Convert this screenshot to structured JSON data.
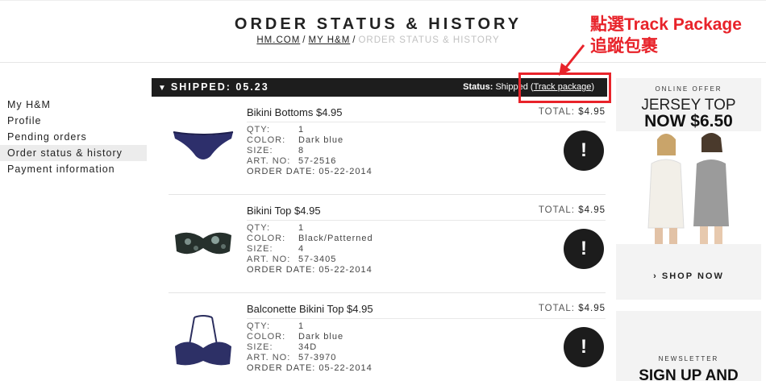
{
  "header": {
    "title": "ORDER STATUS & HISTORY",
    "breadcrumb": [
      "HM.COM",
      "MY H&M",
      "ORDER STATUS & HISTORY"
    ],
    "separator": "/"
  },
  "annotation": {
    "line1": "點選Track Package",
    "line2": "追蹤包裹",
    "color": "#e8232a"
  },
  "sidebar": {
    "items": [
      {
        "label": "My H&M"
      },
      {
        "label": "Profile"
      },
      {
        "label": "Pending orders"
      },
      {
        "label": "Order status & history"
      },
      {
        "label": "Payment information"
      }
    ]
  },
  "shipment": {
    "title": "SHIPPED: 05.23",
    "status_label": "Status:",
    "status_value": "Shipped",
    "track_label": "Track package"
  },
  "items": [
    {
      "name": "Bikini Bottoms $4.95",
      "total_label": "TOTAL:",
      "total_value": "$4.95",
      "details": [
        {
          "k": "QTY:",
          "v": "1"
        },
        {
          "k": "COLOR:",
          "v": "Dark blue"
        },
        {
          "k": "SIZE:",
          "v": "8"
        },
        {
          "k": "ART. NO:",
          "v": "57-2516"
        },
        {
          "k": "ORDER DATE:",
          "v": "05-22-2014"
        }
      ],
      "alert": "!"
    },
    {
      "name": "Bikini Top $4.95",
      "total_label": "TOTAL:",
      "total_value": "$4.95",
      "details": [
        {
          "k": "QTY:",
          "v": "1"
        },
        {
          "k": "COLOR:",
          "v": "Black/Patterned"
        },
        {
          "k": "SIZE:",
          "v": "4"
        },
        {
          "k": "ART. NO:",
          "v": "57-3405"
        },
        {
          "k": "ORDER DATE:",
          "v": "05-22-2014"
        }
      ],
      "alert": "!"
    },
    {
      "name": "Balconette Bikini Top $4.95",
      "total_label": "TOTAL:",
      "total_value": "$4.95",
      "details": [
        {
          "k": "QTY:",
          "v": "1"
        },
        {
          "k": "COLOR:",
          "v": "Dark blue"
        },
        {
          "k": "SIZE:",
          "v": "34D"
        },
        {
          "k": "ART. NO:",
          "v": "57-3970"
        },
        {
          "k": "ORDER DATE:",
          "v": "05-22-2014"
        }
      ],
      "alert": "!"
    }
  ],
  "ad": {
    "offer": "ONLINE OFFER",
    "title": "JERSEY TOP",
    "price": "NOW $6.50",
    "cta": "SHOP NOW"
  },
  "newsletter": {
    "label": "NEWSLETTER",
    "title": "SIGN UP AND"
  }
}
